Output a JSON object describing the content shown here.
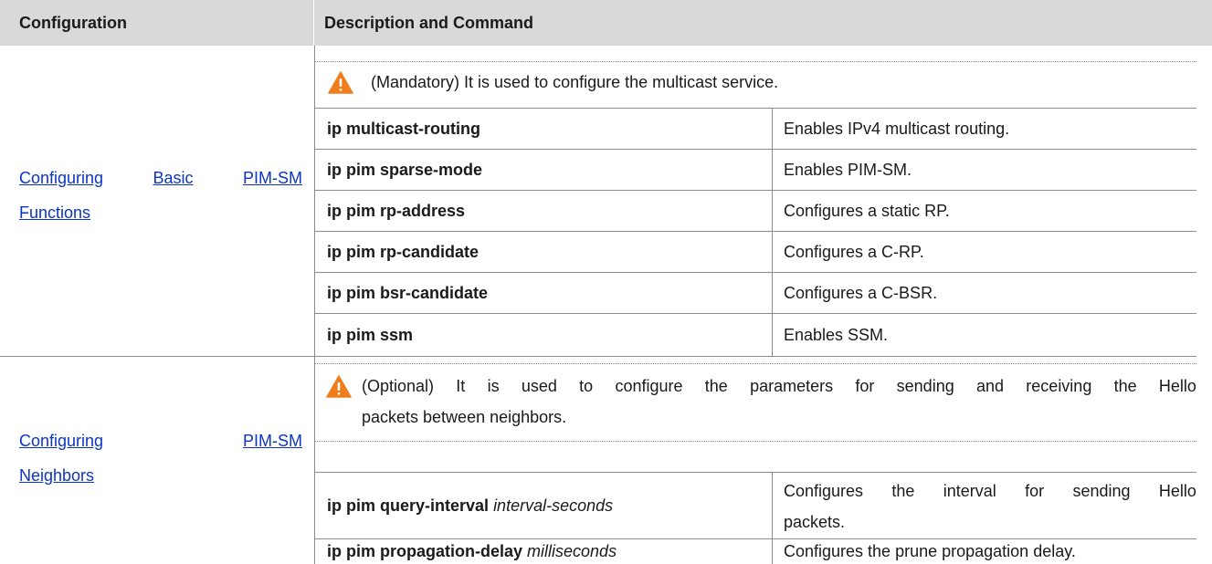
{
  "header": {
    "configuration": "Configuration",
    "description": "Description and Command"
  },
  "sections": [
    {
      "link_words_line1": [
        "Configuring",
        "Basic",
        "PIM-SM"
      ],
      "link_line2": "Functions",
      "note": "(Mandatory) It is used to configure the multicast service.",
      "rows": [
        {
          "cmd": "ip multicast-routing",
          "arg": "",
          "desc": "Enables IPv4 multicast routing."
        },
        {
          "cmd": "ip pim sparse-mode",
          "arg": "",
          "desc": "Enables PIM-SM."
        },
        {
          "cmd": "ip pim rp-address",
          "arg": "",
          "desc": "Configures a static RP."
        },
        {
          "cmd": "ip pim rp-candidate",
          "arg": "",
          "desc": "Configures a C-RP."
        },
        {
          "cmd": "ip pim bsr-candidate",
          "arg": "",
          "desc": "Configures a C-BSR."
        },
        {
          "cmd": "ip pim ssm",
          "arg": "",
          "desc": "Enables SSM."
        }
      ]
    },
    {
      "link_words_line1": [
        "Configuring",
        "PIM-SM"
      ],
      "link_line2": "Neighbors",
      "note_line1_words": [
        "(Optional)",
        "It",
        "is",
        "used",
        "to",
        "configure",
        "the",
        "parameters",
        "for",
        "sending",
        "and",
        "receiving",
        "the",
        "Hello"
      ],
      "note_line2": "packets between neighbors.",
      "rows": [
        {
          "cmd": "ip pim query-interval",
          "arg": "interval-seconds",
          "desc_line1_words": [
            "Configures",
            "the",
            "interval",
            "for",
            "sending",
            "Hello"
          ],
          "desc_line2": "packets."
        },
        {
          "cmd": "ip pim propagation-delay",
          "arg": "milliseconds",
          "desc": "Configures the prune propagation delay."
        }
      ]
    }
  ],
  "icons": {
    "warning": "warning-triangle-icon",
    "warning_color": "#f07d1b"
  }
}
